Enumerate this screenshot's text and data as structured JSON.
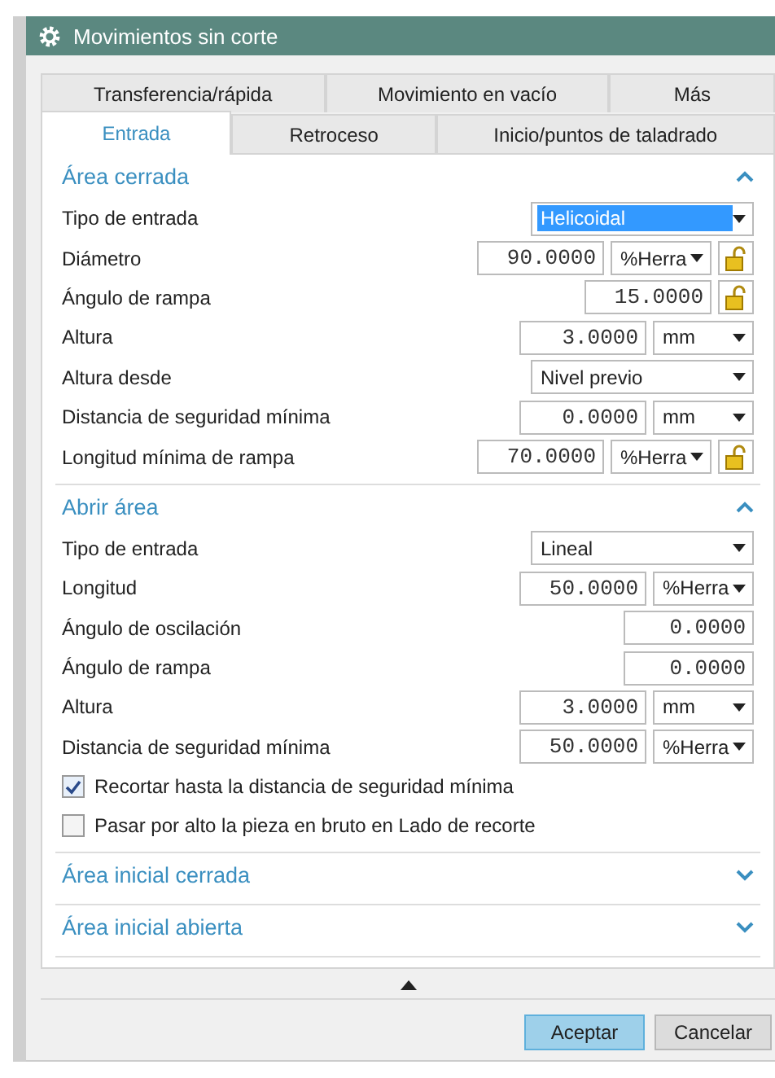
{
  "window": {
    "title": "Movimientos sin corte"
  },
  "tab_rows": [
    [
      {
        "label": "Transferencia/rápida",
        "selected": false
      },
      {
        "label": "Movimiento en vacío",
        "selected": false
      },
      {
        "label": "Más",
        "selected": false
      }
    ],
    [
      {
        "label": "Entrada",
        "selected": true
      },
      {
        "label": "Retroceso",
        "selected": false
      },
      {
        "label": "Inicio/puntos de taladrado",
        "selected": false
      }
    ]
  ],
  "sections": [
    {
      "title": "Área cerrada",
      "expanded": true,
      "rows": [
        {
          "kind": "dropdown",
          "label": "Tipo de entrada",
          "value": "Helicoidal",
          "focused": true
        },
        {
          "kind": "number",
          "label": "Diámetro",
          "value": "90.0000",
          "unit": "%Herra",
          "lock": true
        },
        {
          "kind": "number",
          "label": "Ángulo de rampa",
          "value": "15.0000",
          "lock": true
        },
        {
          "kind": "number",
          "label": "Altura",
          "value": "3.0000",
          "unit": "mm",
          "lock": false
        },
        {
          "kind": "dropdown",
          "label": "Altura desde",
          "value": "Nivel previo",
          "focused": false
        },
        {
          "kind": "number",
          "label": "Distancia de seguridad mínima",
          "value": "0.0000",
          "unit": "mm",
          "lock": false
        },
        {
          "kind": "number",
          "label": "Longitud mínima de rampa",
          "value": "70.0000",
          "unit": "%Herra",
          "lock": true
        }
      ]
    },
    {
      "title": "Abrir área",
      "expanded": true,
      "rows": [
        {
          "kind": "dropdown",
          "label": "Tipo de entrada",
          "value": "Lineal",
          "focused": false
        },
        {
          "kind": "number",
          "label": "Longitud",
          "value": "50.0000",
          "unit": "%Herra",
          "lock": false
        },
        {
          "kind": "number",
          "label": "Ángulo de oscilación",
          "value": "0.0000",
          "lock": false
        },
        {
          "kind": "number",
          "label": "Ángulo de rampa",
          "value": "0.0000",
          "lock": false
        },
        {
          "kind": "number",
          "label": "Altura",
          "value": "3.0000",
          "unit": "mm",
          "lock": false
        },
        {
          "kind": "number",
          "label": "Distancia de seguridad mínima",
          "value": "50.0000",
          "unit": "%Herra",
          "lock": false
        },
        {
          "kind": "checkbox",
          "label": "Recortar hasta la distancia de seguridad mínima",
          "checked": true
        },
        {
          "kind": "checkbox",
          "label": "Pasar por alto la pieza en bruto en Lado de recorte",
          "checked": false
        }
      ]
    },
    {
      "title": "Área inicial cerrada",
      "expanded": false
    },
    {
      "title": "Área inicial abierta",
      "expanded": false
    }
  ],
  "buttons": [
    {
      "label": "Aceptar",
      "selected": true
    },
    {
      "label": "Cancelar",
      "selected": false
    }
  ]
}
